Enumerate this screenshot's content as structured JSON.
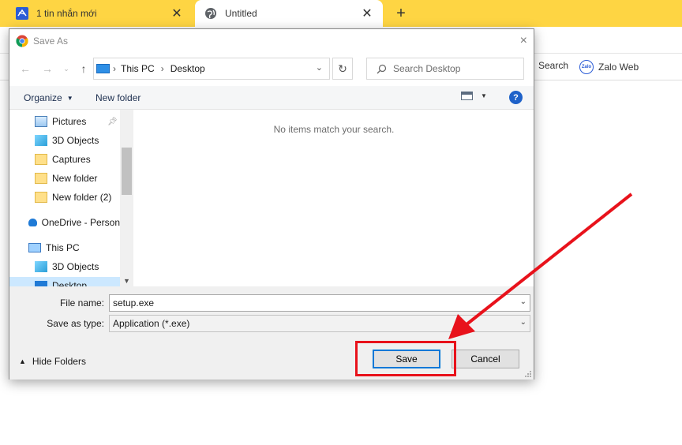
{
  "browser": {
    "tabs": [
      {
        "title": "1 tin nhắn mới",
        "icon": "zalo-favicon-icon"
      },
      {
        "title": "Untitled",
        "icon": "globe-icon"
      }
    ],
    "new_tab_label": "+",
    "bookmarks": [
      {
        "label": "Search"
      },
      {
        "label": "Zalo Web",
        "icon_text": "Zalo"
      }
    ]
  },
  "dialog": {
    "title": "Save As",
    "close_glyph": "×",
    "address": {
      "segments": [
        "This PC",
        "Desktop"
      ]
    },
    "search_placeholder": "Search Desktop",
    "commands": {
      "organize": "Organize",
      "new_folder": "New folder",
      "help": "?"
    },
    "nav_items": [
      {
        "label": "Pictures",
        "icon": "pictures-folder-icon",
        "pinned": true
      },
      {
        "label": "3D Objects",
        "icon": "3d-objects-icon"
      },
      {
        "label": "Captures",
        "icon": "folder-icon"
      },
      {
        "label": "New folder",
        "icon": "folder-icon"
      },
      {
        "label": "New folder (2)",
        "icon": "folder-icon"
      },
      {
        "label": "OneDrive - Person",
        "icon": "onedrive-cloud-icon"
      },
      {
        "label": "This PC",
        "icon": "computer-icon"
      },
      {
        "label": "3D Objects",
        "icon": "3d-objects-icon"
      },
      {
        "label": "Desktop",
        "icon": "desktop-icon",
        "selected": true
      }
    ],
    "empty_message": "No items match your search.",
    "file_name_label": "File name:",
    "file_name_value": "setup.exe",
    "save_type_label": "Save as type:",
    "save_type_value": "Application (*.exe)",
    "hide_folders": "Hide Folders",
    "save_button": "Save",
    "cancel_button": "Cancel"
  },
  "colors": {
    "tabstrip": "#fed543",
    "highlight": "#e8121b",
    "selection": "#cce8ff",
    "accent": "#0078d7"
  }
}
